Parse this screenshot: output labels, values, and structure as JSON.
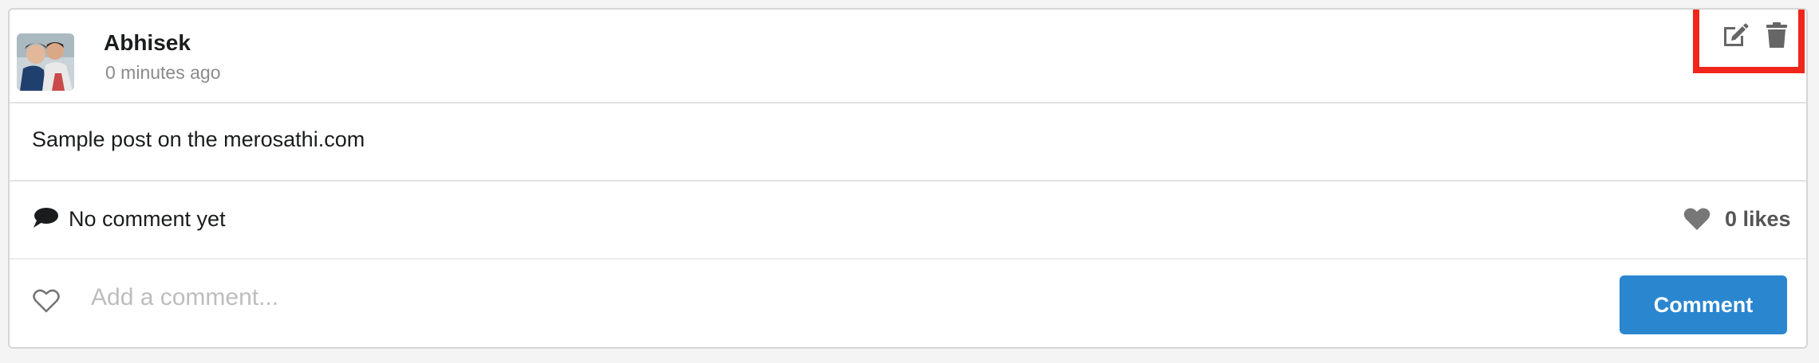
{
  "post": {
    "author": "Abhisek",
    "timestamp": "0 minutes ago",
    "text": "Sample post on the merosathi.com",
    "comments_status": "No comment yet",
    "likes": "0 likes"
  },
  "comment_form": {
    "placeholder": "Add a comment...",
    "value": "",
    "submit_label": "Comment"
  },
  "icons": {
    "edit": "edit-icon",
    "delete": "trash-icon",
    "comment": "comment-bubble-icon",
    "like": "heart-icon",
    "like_outline": "heart-outline-icon"
  },
  "colors": {
    "button": "#2b86d0",
    "highlight_box": "#f0251b",
    "text": "#1b1c1d",
    "muted": "#8a8a8a"
  }
}
